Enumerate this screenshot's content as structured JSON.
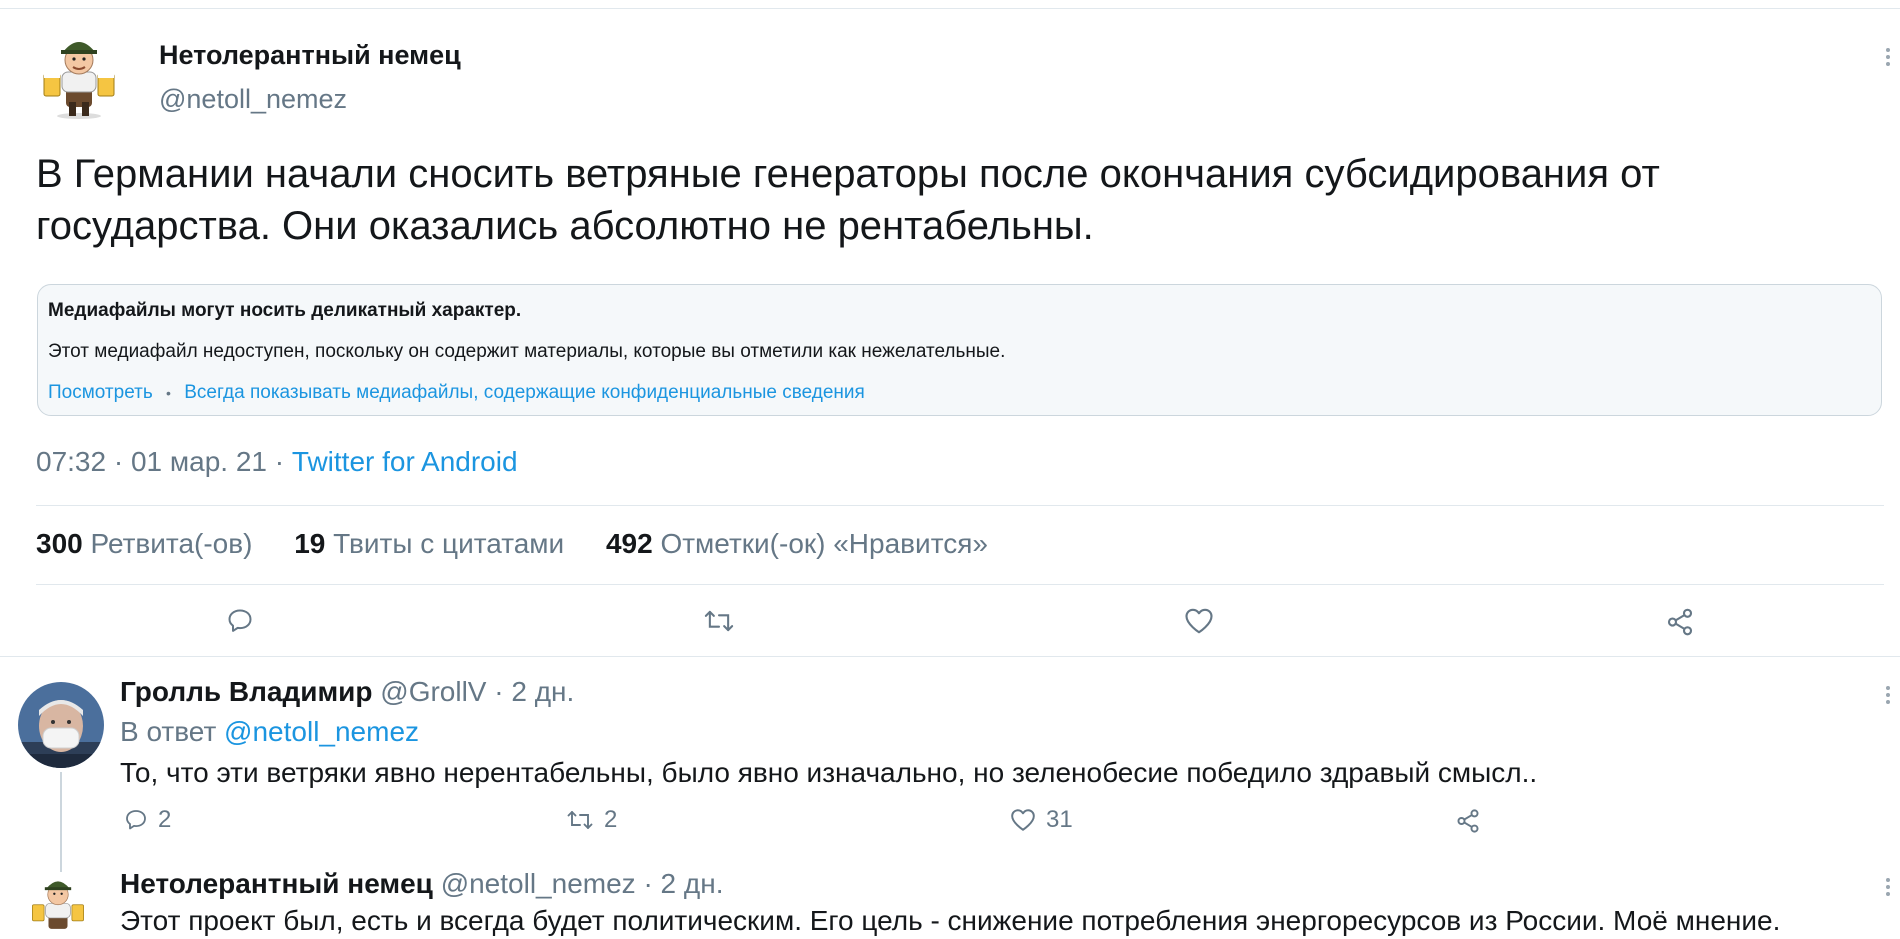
{
  "main_tweet": {
    "author_name": "Нетолерантный немец",
    "author_handle": "@netoll_nemez",
    "text": "В Германии начали сносить ветряные генераторы после окончания субсидирования от государства. Они оказались абсолютно не рентабельны.",
    "sensitive": {
      "title": "Медиафайлы могут носить деликатный характер.",
      "description": "Этот медиафайл недоступен, поскольку он содержит материалы, которые вы отметили как нежелательные.",
      "view_link": "Посмотреть",
      "separator": "•",
      "always_show_link": "Всегда показывать медиафайлы, содержащие конфиденциальные сведения"
    },
    "meta": {
      "time": "07:32",
      "date": "01 мар. 21",
      "dot": "·",
      "source": "Twitter for Android"
    },
    "stats": {
      "retweets_count": "300",
      "retweets_label": "Ретвита(-ов)",
      "quotes_count": "19",
      "quotes_label": "Твиты с цитатами",
      "likes_count": "492",
      "likes_label": "Отметки(-ок) «Нравится»"
    }
  },
  "replies": [
    {
      "author_name": "Гролль Владимир",
      "author_handle": "@GrollV",
      "age": "· 2 дн.",
      "in_reply_prefix": "В ответ",
      "in_reply_handle": "@netoll_nemez",
      "text": "То, что эти ветряки явно нерентабельны, было явно изначально, но зеленобесие победило здравый смысл..",
      "reply_count": "2",
      "retweet_count": "2",
      "like_count": "31"
    },
    {
      "author_name": "Нетолерантный немец",
      "author_handle": "@netoll_nemez",
      "age": "· 2 дн.",
      "text": "Этот проект был, есть и всегда будет политическим. Его цель - снижение потребления энергоресурсов из России. Моё мнение."
    }
  ],
  "colors": {
    "link": "#1b95e0",
    "muted": "#657786",
    "divider": "#e1e8ed",
    "notice_bg": "#f5f8fa"
  }
}
